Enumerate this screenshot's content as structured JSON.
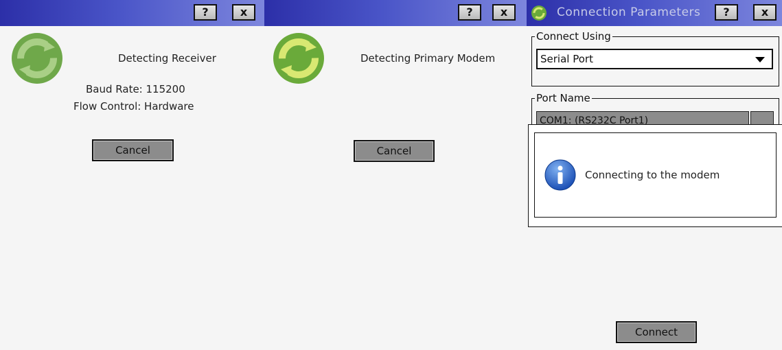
{
  "dialog_receiver": {
    "help_button": "?",
    "close_button": "x",
    "status": "Detecting Receiver",
    "baud_rate": "Baud Rate: 115200",
    "flow_control": "Flow Control: Hardware",
    "cancel_button": "Cancel",
    "icon": "sync-icon"
  },
  "dialog_modem": {
    "help_button": "?",
    "close_button": "x",
    "status": "Detecting Primary Modem",
    "cancel_button": "Cancel",
    "icon": "sync-icon"
  },
  "dialog_connection": {
    "title": "Connection Parameters",
    "help_button": "?",
    "close_button": "x",
    "connect_using": {
      "legend": "Connect Using",
      "selected": "Serial Port"
    },
    "port_name": {
      "legend": "Port Name",
      "value": "COM1: (RS232C Port1)"
    },
    "message_box": {
      "icon": "info-icon",
      "text": "Connecting to the modem"
    },
    "connect_button": "Connect"
  },
  "colors": {
    "titlebar_start": "#2c2fa8",
    "titlebar_end": "#7d86dd",
    "icon_green": "#6aaa3a",
    "button_gray": "#8c8c8c"
  }
}
